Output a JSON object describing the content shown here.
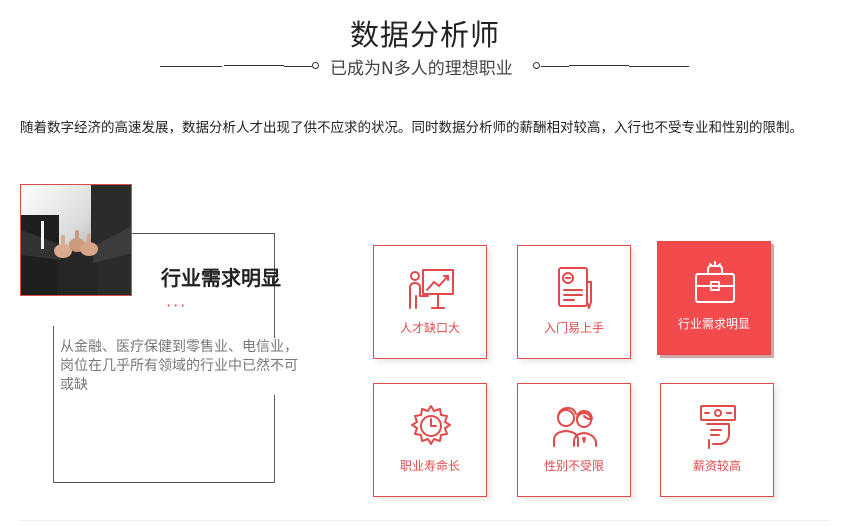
{
  "header": {
    "title": "数据分析师",
    "subtitle": "已成为N多人的理想职业"
  },
  "intro": {
    "text": "随着数字经济的高速发展，数据分析人才出现了供不应求的状况。同时数据分析师的薪酬相对较高，入行也不受专业和性别的限制。"
  },
  "feature": {
    "heading": "行业需求明显",
    "dots": "···",
    "description": "从金融、医疗保健到零售业、电信业，岗位在几乎所有领域的行业中已然不可或缺"
  },
  "cards": [
    {
      "label": "人才缺口大",
      "icon": "presentation-chart-icon"
    },
    {
      "label": "入门易上手",
      "icon": "certificate-icon"
    },
    {
      "label": "行业需求明显",
      "icon": "briefcase-icon"
    },
    {
      "label": "职业寿命长",
      "icon": "gear-clock-icon"
    },
    {
      "label": "性别不受限",
      "icon": "couple-icon"
    },
    {
      "label": "薪资较高",
      "icon": "money-hand-icon"
    }
  ],
  "colors": {
    "accent": "#e24a4a",
    "active_card": "#f34a4d",
    "text": "#222222",
    "muted": "#777777"
  }
}
